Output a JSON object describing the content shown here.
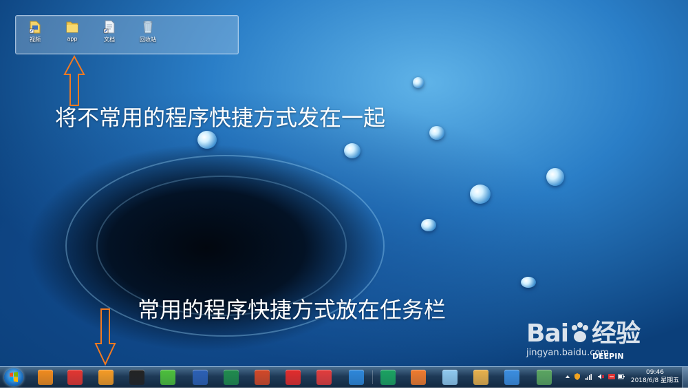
{
  "desktop": {
    "fence_icons": [
      {
        "label": "视频",
        "icon": "video-shortcut-icon"
      },
      {
        "label": "app",
        "icon": "folder-icon"
      },
      {
        "label": "文档",
        "icon": "document-shortcut-icon"
      },
      {
        "label": "回收站",
        "icon": "recycle-bin-icon"
      }
    ],
    "annotation_top": "将不常用的程序快捷方式发在一起",
    "annotation_bottom": "常用的程序快捷方式放在任务栏",
    "arrow_color": "#f47a20"
  },
  "taskbar": {
    "pinned": [
      {
        "name": "search-app-icon",
        "color": "#f08a1c"
      },
      {
        "name": "red-g-app-icon",
        "color": "#e3342f"
      },
      {
        "name": "uc-browser-icon",
        "color": "#f59a23"
      },
      {
        "name": "qq-icon",
        "color": "#222222"
      },
      {
        "name": "wechat-icon",
        "color": "#4cbf3a"
      },
      {
        "name": "word-icon",
        "color": "#2b5fb4"
      },
      {
        "name": "excel-icon",
        "color": "#1f8a4c"
      },
      {
        "name": "powerpoint-icon",
        "color": "#d24726"
      },
      {
        "name": "netease-music-icon",
        "color": "#e22a2a"
      },
      {
        "name": "xmind-icon",
        "color": "#e23b3b"
      },
      {
        "name": "wps-writer-icon",
        "color": "#2d86d9"
      },
      {
        "name": "wps-spreadsheet-icon",
        "color": "#1aa260"
      },
      {
        "name": "wps-presentation-icon",
        "color": "#f07a2c"
      },
      {
        "name": "notes-icon",
        "color": "#8fc9ef"
      },
      {
        "name": "paint-icon",
        "color": "#e8b04a"
      },
      {
        "name": "app-launcher-icon",
        "color": "#3a8de0"
      },
      {
        "name": "monitor-app-icon",
        "color": "#5aa55f"
      }
    ],
    "clock": {
      "time": "09:46",
      "date": "2018/6/8 星期五"
    }
  },
  "watermark": {
    "brand": "Bai",
    "brand_cn": "经验",
    "sub": "jingyan.baidu.com",
    "tag": "DEEPIN"
  }
}
